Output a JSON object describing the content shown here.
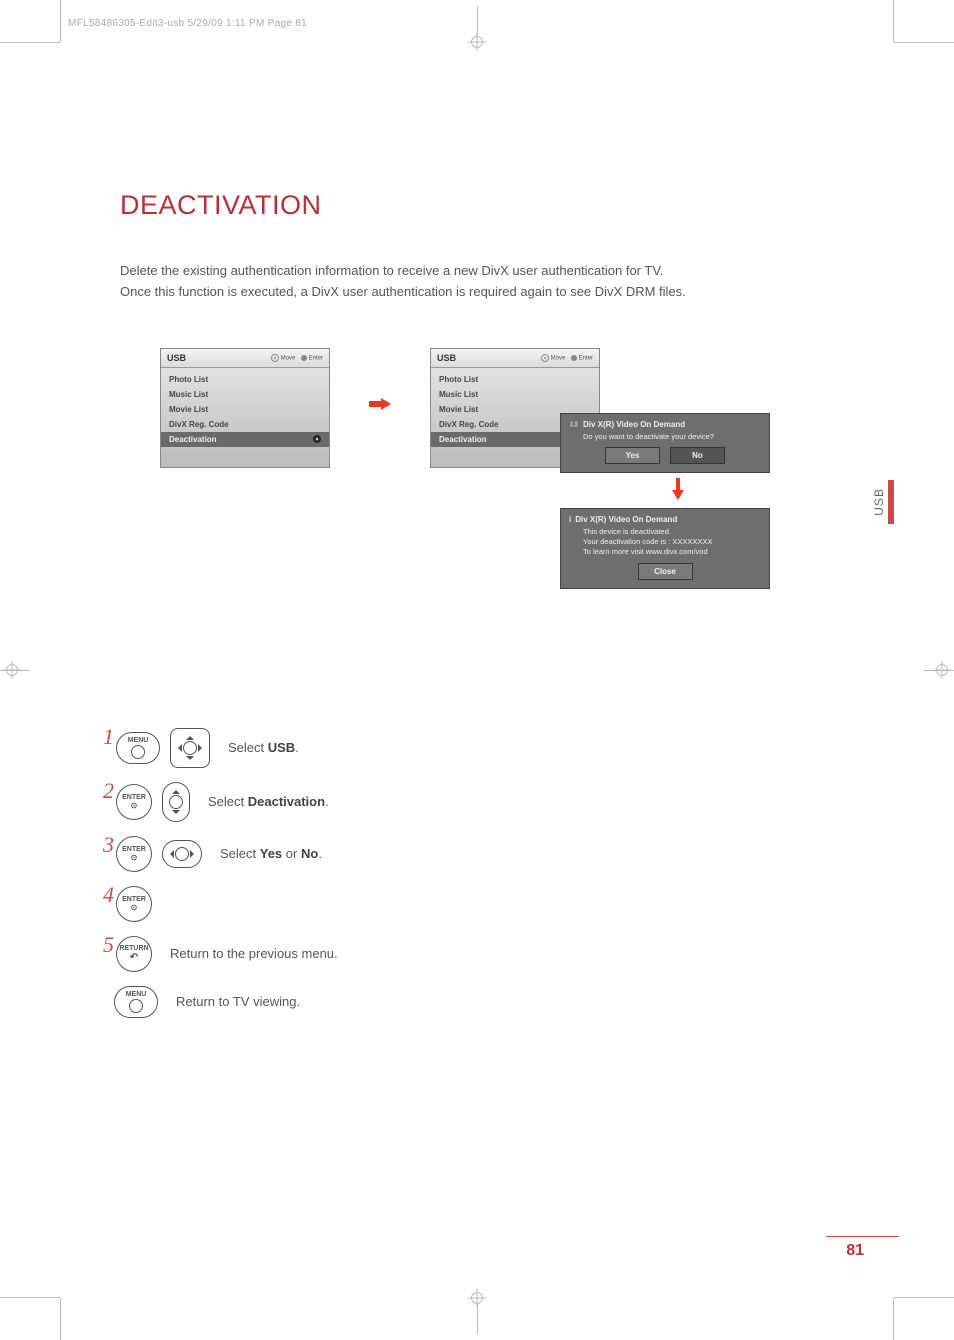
{
  "header_slug": "MFL58486305-Edit3-usb  5/29/09  1:11 PM  Page 81",
  "title": "DEACTIVATION",
  "intro_line1": "Delete the existing authentication information to receive a new DivX user authentication for TV.",
  "intro_line2": "Once this function is executed, a DivX user authentication is required again to see DivX DRM files.",
  "osd": {
    "title": "USB",
    "hint_move": "Move",
    "hint_enter": "Enter",
    "items": {
      "photo": "Photo List",
      "music": "Music List",
      "movie": "Movie List",
      "divx": "DivX Reg. Code",
      "deact": "Deactivation"
    }
  },
  "dialog1": {
    "title": "Div X(R) Video On Demand",
    "body": "Do you want to deactivate your device?",
    "yes": "Yes",
    "no": "No"
  },
  "dialog2": {
    "title": "Div X(R) Video On Demand",
    "body1": "This device is deactivated.",
    "body2": "Your deactivation code is : XXXXXXXX",
    "body3": "To learn more visit www.divx.com/vod",
    "close": "Close"
  },
  "steps": {
    "n1": "1",
    "t1_a": "Select ",
    "t1_b": "USB",
    "t1_c": ".",
    "n2": "2",
    "t2_a": "Select ",
    "t2_b": "Deactivation",
    "t2_c": ".",
    "n3": "3",
    "t3_a": "Select ",
    "t3_b": "Yes",
    "t3_c": " or ",
    "t3_d": "No",
    "t3_e": ".",
    "n4": "4",
    "n5": "5",
    "t5": "Return to the previous menu.",
    "t6": "Return to TV viewing."
  },
  "remote": {
    "menu": "MENU",
    "enter": "ENTER",
    "return": "RETURN"
  },
  "side_tab": "USB",
  "page_num": "81"
}
